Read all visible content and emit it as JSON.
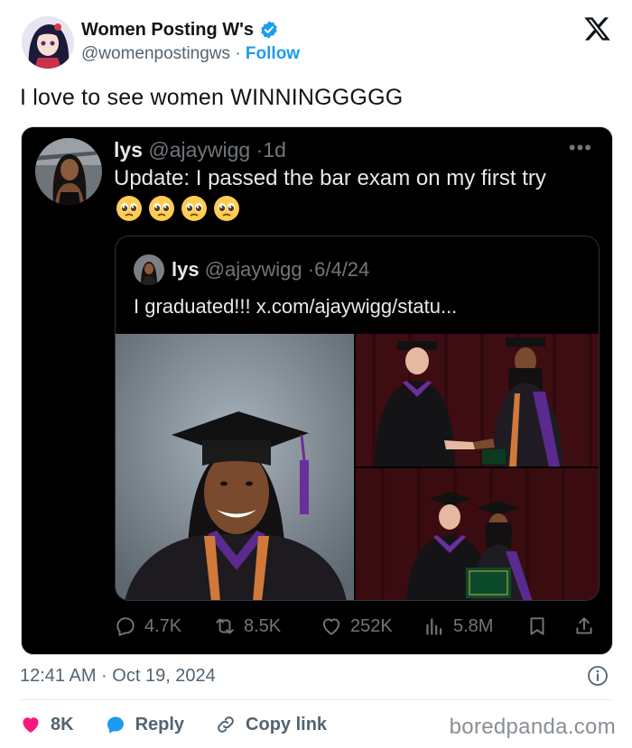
{
  "author": {
    "name": "Women Posting W's",
    "handle": "@womenpostingws",
    "separator": "·",
    "follow_label": "Follow",
    "verified_icon": "verified-badge-icon"
  },
  "tweet_text": "I love to see women WINNINGGGGG",
  "screenshot": {
    "name": "lys",
    "handle": "@ajaywigg",
    "time": "1d",
    "text": "Update: I passed the bar exam on my first try",
    "emojis": [
      "pleading-face-icon",
      "pleading-face-icon",
      "pleading-face-icon",
      "pleading-face-icon"
    ],
    "quote": {
      "name": "lys",
      "handle": "@ajaywigg",
      "date": "6/4/24",
      "text": "I graduated!!! x.com/ajaywigg/statu..."
    },
    "stats": {
      "replies": "4.7K",
      "retweets": "8.5K",
      "likes": "252K",
      "views": "5.8M"
    }
  },
  "footer": {
    "timestamp": "12:41 AM · Oct 19, 2024",
    "likes": "8K",
    "reply_label": "Reply",
    "copy_link_label": "Copy link"
  },
  "watermark": "boredpanda.com",
  "colors": {
    "accent": "#1d9bf0",
    "like": "#f91880",
    "dark_bg": "#000000"
  }
}
